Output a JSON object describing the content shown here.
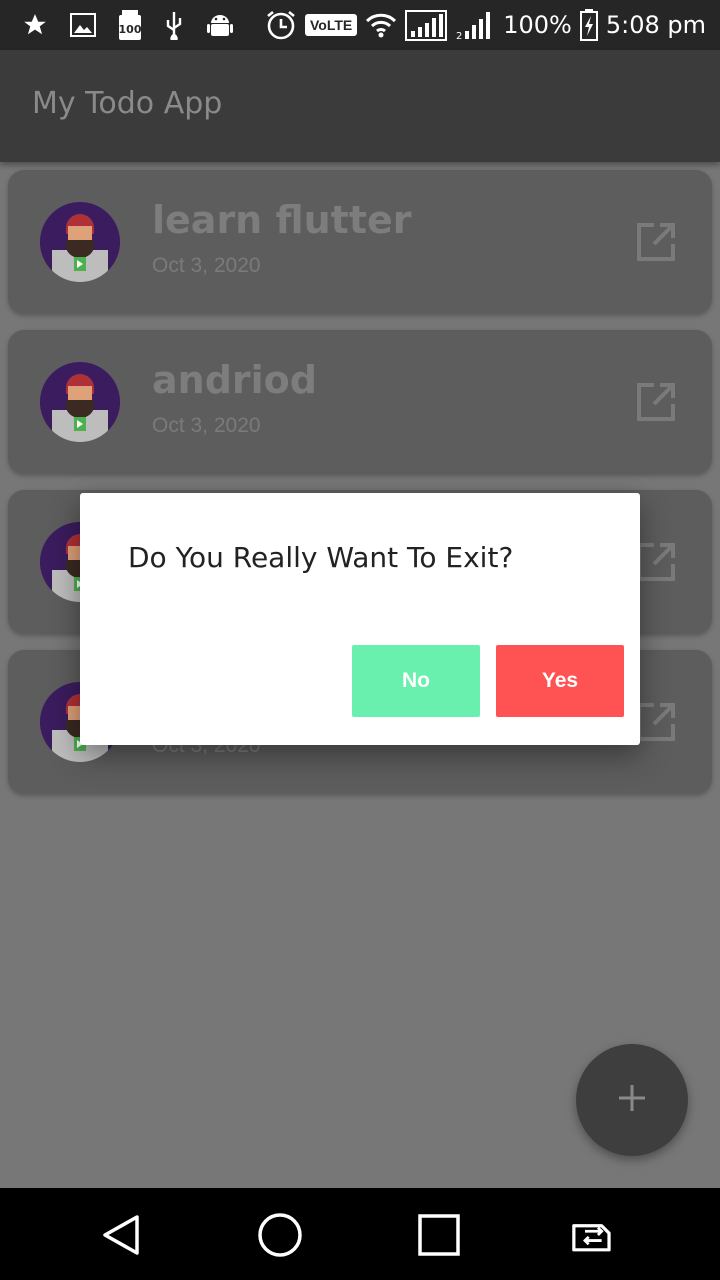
{
  "status_bar": {
    "battery": "100%",
    "time": "5:08 pm",
    "volte": "VoLTE",
    "icons": [
      "star-icon",
      "image-icon",
      "hundred-icon",
      "usb-icon",
      "android-icon",
      "alarm-icon",
      "volte-icon",
      "wifi-icon",
      "signal-icon",
      "signal-icon",
      "battery-icon"
    ]
  },
  "app_bar": {
    "title": "My Todo App"
  },
  "todos": [
    {
      "title": "learn flutter",
      "date": "Oct 3, 2020"
    },
    {
      "title": "andriod",
      "date": "Oct 3, 2020"
    },
    {
      "title": "",
      "date": ""
    },
    {
      "title": "",
      "date": "Oct 3, 2020"
    }
  ],
  "dialog": {
    "title": "Do You Really Want To Exit?",
    "no_label": "No",
    "yes_label": "Yes",
    "no_color": "#69f0ae",
    "yes_color": "#ff5252"
  },
  "fab": {
    "icon": "plus-icon"
  },
  "nav_bar": {
    "icons": [
      "back-icon",
      "home-icon",
      "recents-icon",
      "switch-sim-icon"
    ]
  }
}
